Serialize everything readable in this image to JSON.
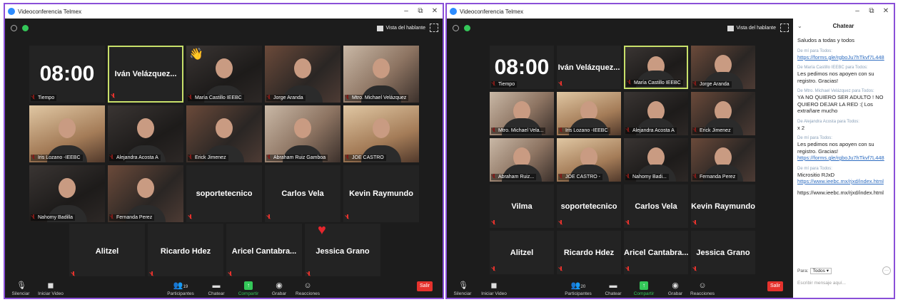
{
  "windowA": {
    "title": "Videoconferencia Telmex",
    "view_button": "Vista del hablante",
    "tiles": [
      {
        "kind": "text",
        "text": "08:00",
        "label": "Tiempo",
        "size": "xl"
      },
      {
        "kind": "text",
        "text": "Iván  Velázquez...",
        "highlight": true
      },
      {
        "kind": "video",
        "label": "María Castillo IEEBC",
        "emoji": "👋"
      },
      {
        "kind": "video",
        "label": "Jorge Aranda"
      },
      {
        "kind": "video",
        "label": "Mtro. Michael Velázquez"
      },
      {
        "kind": "video",
        "label": "Iris Lozano -IEEBC"
      },
      {
        "kind": "video",
        "label": "Alejandra Acosta A"
      },
      {
        "kind": "video",
        "label": "Erick Jimenez"
      },
      {
        "kind": "video",
        "label": "Abraham Ruiz Gamboa"
      },
      {
        "kind": "video",
        "label": "JOE CASTRO"
      },
      {
        "kind": "video",
        "label": "Nahomy Badilla"
      },
      {
        "kind": "video",
        "label": "Fernanda Perez"
      },
      {
        "kind": "text",
        "text": "soportetecnico"
      },
      {
        "kind": "text",
        "text": "Carlos Vela"
      },
      {
        "kind": "text",
        "text": "Kevin Raymundo"
      },
      {
        "kind": "text",
        "text": "Alitzel"
      },
      {
        "kind": "text",
        "text": "Ricardo Hdez"
      },
      {
        "kind": "text",
        "text": "Aricel  Cantabra..."
      },
      {
        "kind": "text",
        "text": "Jessica Grano",
        "heart": true
      }
    ],
    "toolbar": {
      "mute": "Silenciar",
      "video": "Iniciar Video",
      "participants": "Participantes",
      "participants_count": "19",
      "chat": "Chatear",
      "share": "Compartir",
      "record": "Grabar",
      "reactions": "Reacciones",
      "leave": "Salir"
    }
  },
  "windowB": {
    "title": "Videoconferencia Telmex",
    "view_button": "Vista del hablante",
    "tiles": [
      {
        "kind": "text",
        "text": "08:00",
        "label": "Tiempo",
        "size": "xl"
      },
      {
        "kind": "text",
        "text": "Iván  Velázquez..."
      },
      {
        "kind": "video",
        "label": "María Castillo IEEBC",
        "highlight": true
      },
      {
        "kind": "video",
        "label": "Jorge Aranda"
      },
      {
        "kind": "video",
        "label": "Mtro. Michael Vela..."
      },
      {
        "kind": "video",
        "label": "Iris Lozano -IEEBC"
      },
      {
        "kind": "video",
        "label": "Alejandra Acosta A"
      },
      {
        "kind": "video",
        "label": "Erick Jimenez"
      },
      {
        "kind": "video",
        "label": "Abraham Ruiz..."
      },
      {
        "kind": "video",
        "label": "JOE CASTRO -"
      },
      {
        "kind": "video",
        "label": "Nahomy Badi..."
      },
      {
        "kind": "video",
        "label": "Fernanda Perez"
      },
      {
        "kind": "text",
        "text": "Vilma"
      },
      {
        "kind": "text",
        "text": "soportetecnico"
      },
      {
        "kind": "text",
        "text": "Carlos Vela"
      },
      {
        "kind": "text",
        "text": "Kevin Raymundo"
      },
      {
        "kind": "text",
        "text": "Alitzel"
      },
      {
        "kind": "text",
        "text": "Ricardo Hdez"
      },
      {
        "kind": "text",
        "text": "Aricel  Cantabra..."
      },
      {
        "kind": "text",
        "text": "Jessica Grano"
      }
    ],
    "toolbar": {
      "mute": "Silenciar",
      "video": "Iniciar Video",
      "participants": "Participantes",
      "participants_count": "20",
      "chat": "Chatear",
      "share": "Compartir",
      "record": "Grabar",
      "reactions": "Reacciones",
      "leave": "Salir"
    }
  },
  "chat": {
    "title": "Chatear",
    "messages": [
      {
        "from": "",
        "text": "Saludos a todas y todos",
        "link": ""
      },
      {
        "from": "De mí para Todos:",
        "text": "",
        "link": "https://forms.gle/rgboJu7hTkvf7L448"
      },
      {
        "from": "De María Castillo IEEBC para Todos:",
        "text": "Les pedimos nos apoyen con su registro. Gracias!",
        "link": ""
      },
      {
        "from": "De Mtro. Michael Velázquez para Todos:",
        "text": "YA NO QUIERO SER ADULTO ! NO QUIERO DEJAR LA RED :( Los extrañare mucho",
        "link": ""
      },
      {
        "from": "De Alejandra Acosta para Todos:",
        "text": "x 2",
        "link": ""
      },
      {
        "from": "De mí para Todos:",
        "text": "Les pedimos nos apoyen con su registro. Gracias!",
        "link": "https://forms.gle/rgboJu7hTkvf7L448"
      },
      {
        "from": "De mí para Todos:",
        "text": "Micrositio RJxD",
        "link": "https://www.ieebc.mx/rjxd/index.html"
      }
    ],
    "extra_link": "https://www.ieebc.mx/rjxd/index.html",
    "to_label": "Para:",
    "to_value": "Todos",
    "placeholder": "Escribir mensaje aquí..."
  },
  "colors": {
    "accent": "#8a4fd8",
    "share": "#34c759",
    "leave": "#e5322d",
    "highlight": "#c8e06a"
  }
}
